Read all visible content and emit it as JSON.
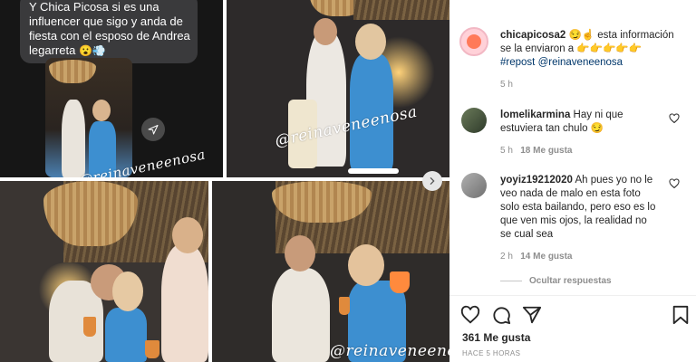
{
  "chat": {
    "lines": [
      "Y Chica Picosa si es una",
      "influencer que sigo y anda de",
      "fiesta con el esposo de Andrea",
      "legarreta"
    ],
    "emoji_trail": "😮💨"
  },
  "watermarks": {
    "chat_thumb": "@reinaveneenosa",
    "top_right": "@reinaveneenosa",
    "bottom_right": "@reinaveneenosa"
  },
  "post": {
    "username": "chicapicosa2",
    "caption_line1": "😏☝ esta información",
    "caption_line2": "se la enviaron a 👉👉👉👉👉",
    "hashtag": "#repost",
    "mention": "@reinaveneenosa",
    "age": "5 h"
  },
  "comments": [
    {
      "username": "lomelikarmina",
      "text_line1": "Hay ni que",
      "text_line2": "estuviera tan chulo 😏",
      "age": "5 h",
      "likes": "18 Me gusta"
    },
    {
      "username": "yoyiz19212020",
      "text_line1": "Ah pues yo no le",
      "text_line2": "veo nada de malo en esta foto",
      "text_line3": "solo esta bailando, pero eso es lo",
      "text_line4": "que ven mis ojos, la realidad no",
      "text_line5": "se cual sea",
      "age": "2 h",
      "likes": "14 Me gusta"
    }
  ],
  "hide_replies": "Ocultar respuestas",
  "footer": {
    "likes": "361 Me gusta",
    "posted": "HACE 5 HORAS"
  },
  "icons": {
    "like": "heart-icon",
    "comment": "comment-icon",
    "share": "paper-plane-icon",
    "save": "bookmark-icon",
    "next": "chevron-right-icon"
  },
  "colors": {
    "link": "#00376b",
    "muted": "#8e8e8e",
    "dress_blue": "#3d8fd0"
  }
}
